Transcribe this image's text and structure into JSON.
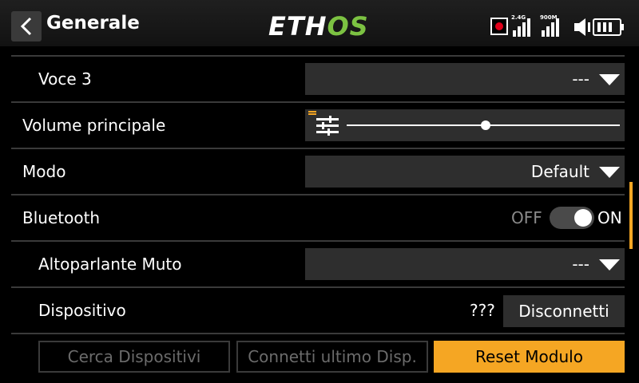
{
  "header": {
    "title": "Generale",
    "logo_main": "ETH",
    "logo_accent": "OS",
    "signal_label_1": "2.4G",
    "signal_label_2": "900M"
  },
  "rows": {
    "voce3": {
      "label": "Voce 3",
      "value": "---"
    },
    "volume": {
      "label": "Volume principale",
      "level": 0.51
    },
    "modo": {
      "label": "Modo",
      "value": "Default"
    },
    "bluetooth": {
      "label": "Bluetooth",
      "off_label": "OFF",
      "on_label": "ON",
      "state": "on"
    },
    "mute": {
      "label": "Altoparlante Muto",
      "value": "---"
    },
    "device": {
      "label": "Dispositivo",
      "value": "???",
      "button": "Disconnetti"
    }
  },
  "buttons": {
    "search": "Cerca Dispositivi",
    "connect_last": "Connetti ultimo Disp.",
    "reset": "Reset Modulo"
  },
  "colors": {
    "accent": "#f5a623",
    "logo_green": "#7cc242",
    "record": "#e1001a"
  }
}
